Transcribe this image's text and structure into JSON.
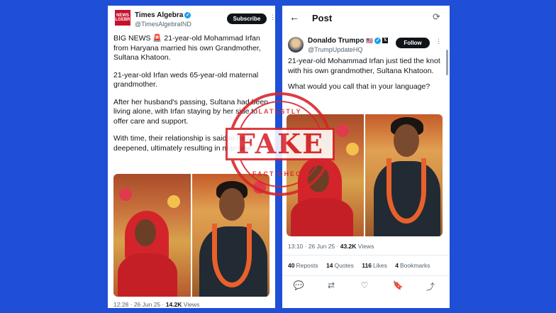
{
  "left_tweet": {
    "avatar_text": "NEWS ALGEBRA",
    "name": "Times Algebra",
    "handle": "@TimesAlgebraIND",
    "subscribe_label": "Subscribe",
    "more": "⋮",
    "paragraphs": [
      "BIG NEWS 🚨 21-year-old Mohammad Irfan from Haryana married his own Grandmother, Sultana Khatoon.",
      "21-year-old Irfan weds 65-year-old maternal grandmother.",
      "After her husband's passing, Sultana had been living alone, with Irfan staying by her side to offer care and support.",
      "With time, their relationship is said to have deepened, ultimately resulting in marriage."
    ],
    "time": "12:28 · 26 Jun 25 ·",
    "views_count": "14.2K",
    "views_label": "Views"
  },
  "right_tweet": {
    "back": "←",
    "title": "Post",
    "refresh": "⟳",
    "name": "Donaldo Trumpo",
    "flag": "🇺🇸",
    "handle": "@TrumpUpdateHQ",
    "follow_label": "Follow",
    "more": "⋮",
    "paragraphs": [
      "21-year-old Mohammad Irfan just tied the knot with his own grandmother, Sultana Khatoon.",
      "What would you call that in your language?"
    ],
    "time": "13:10 · 26 Jun 25 ·",
    "views_count": "43.2K",
    "views_label": "Views",
    "stats": [
      {
        "count": "40",
        "label": "Reposts"
      },
      {
        "count": "14",
        "label": "Quotes"
      },
      {
        "count": "116",
        "label": "Likes"
      },
      {
        "count": "4",
        "label": "Bookmarks"
      }
    ],
    "actions": {
      "reply": "💬",
      "repost": "⇄",
      "like": "♡",
      "bookmark": "🔖",
      "share": "⤴"
    }
  },
  "stamp": {
    "word": "FAKE",
    "top_text": "LATESTLY",
    "bottom_text": "FACT CHECK"
  },
  "colors": {
    "background": "#1f4fd6",
    "stamp": "#d8232a",
    "verified": "#1d9bf0"
  }
}
